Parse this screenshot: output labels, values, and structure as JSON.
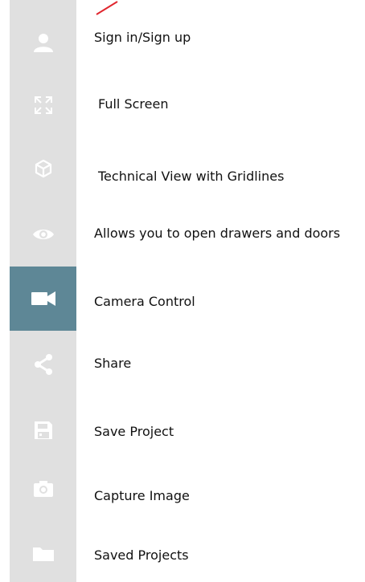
{
  "colors": {
    "sidebar_bg": "#e0e0e0",
    "icon": "#ffffff",
    "active_bg": "#5e8796",
    "annotation": "#e0262e"
  },
  "menu": [
    {
      "icon": "user-icon",
      "label": "Sign in/Sign up"
    },
    {
      "icon": "fullscreen-icon",
      "label": "Full Screen"
    },
    {
      "icon": "cube-icon",
      "label": "Technical View with Gridlines"
    },
    {
      "icon": "eye-icon",
      "label": "Allows you to open drawers and doors"
    },
    {
      "icon": "video-camera-icon",
      "label": "Camera Control",
      "active": true
    },
    {
      "icon": "share-icon",
      "label": "Share"
    },
    {
      "icon": "floppy-disk-icon",
      "label": "Save Project"
    },
    {
      "icon": "camera-icon",
      "label": "Capture Image"
    },
    {
      "icon": "folder-icon",
      "label": "Saved Projects"
    }
  ]
}
